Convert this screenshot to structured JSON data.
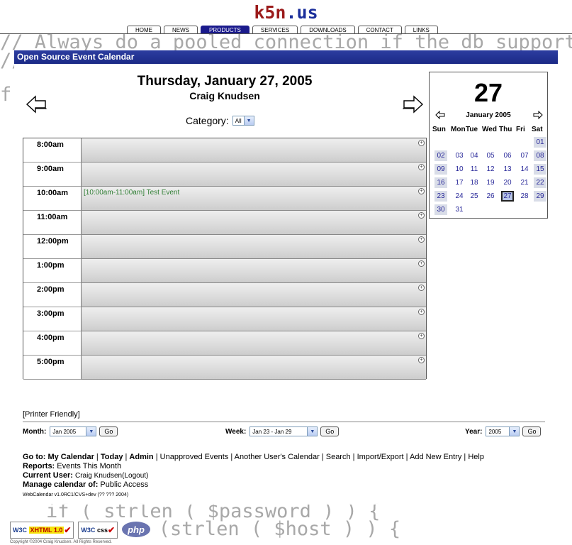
{
  "site": {
    "title_main": "k5n",
    "title_dot": ".",
    "title_tld": "us"
  },
  "nav": {
    "tabs": [
      {
        "label": "HOME",
        "active": false
      },
      {
        "label": "NEWS",
        "active": false
      },
      {
        "label": "PRODUCTS",
        "active": true
      },
      {
        "label": "SERVICES",
        "active": false
      },
      {
        "label": "DOWNLOADS",
        "active": false
      },
      {
        "label": "CONTACT",
        "active": false
      },
      {
        "label": "LINKS",
        "active": false
      }
    ]
  },
  "background_code": [
    "// Always do a pooled connection if the db supports",
    "//",
    "f",
    "",
    "",
    "",
    "",
    "",
    "",
    "",
    "",
    "",
    "",
    "",
    "",
    "",
    "",
    "    if ( strlen ( $password ) ) {",
    "       (strlen ( $host ) ) {"
  ],
  "panel": {
    "title": "Open Source Event Calendar"
  },
  "day": {
    "title": "Thursday, January 27, 2005",
    "user": "Craig Knudsen"
  },
  "category": {
    "label": "Category:",
    "value": "All"
  },
  "schedule": {
    "slots": [
      {
        "time": "8:00am",
        "event": ""
      },
      {
        "time": "9:00am",
        "event": ""
      },
      {
        "time": "10:00am",
        "event": "[10:00am-11:00am] Test Event"
      },
      {
        "time": "11:00am",
        "event": ""
      },
      {
        "time": "12:00pm",
        "event": ""
      },
      {
        "time": "1:00pm",
        "event": ""
      },
      {
        "time": "2:00pm",
        "event": ""
      },
      {
        "time": "3:00pm",
        "event": ""
      },
      {
        "time": "4:00pm",
        "event": ""
      },
      {
        "time": "5:00pm",
        "event": ""
      }
    ]
  },
  "mini_calendar": {
    "day": "27",
    "month": "January 2005",
    "weekdays": [
      "Sun",
      "Mon",
      "Tue",
      "Wed",
      "Thu",
      "Fri",
      "Sat"
    ],
    "weeks": [
      [
        "",
        "",
        "",
        "",
        "",
        "",
        "01"
      ],
      [
        "02",
        "03",
        "04",
        "05",
        "06",
        "07",
        "08"
      ],
      [
        "09",
        "10",
        "11",
        "12",
        "13",
        "14",
        "15"
      ],
      [
        "16",
        "17",
        "18",
        "19",
        "20",
        "21",
        "22"
      ],
      [
        "23",
        "24",
        "25",
        "26",
        "27",
        "28",
        "29"
      ],
      [
        "30",
        "31",
        "",
        "",
        "",
        "",
        ""
      ]
    ],
    "today": "27"
  },
  "footer": {
    "printer_friendly": "[Printer Friendly]",
    "month_label": "Month:",
    "month_value": "Jan 2005",
    "week_label": "Week:",
    "week_value": "Jan 23 - Jan 29",
    "year_label": "Year:",
    "year_value": "2005",
    "go_label": "Go",
    "goto_label": "Go to:",
    "goto_links": [
      "My Calendar",
      "Today",
      "Admin",
      "Unapproved Events",
      "Another User's Calendar",
      "Search",
      "Import/Export",
      "Add New Entry",
      "Help"
    ],
    "reports_label": "Reports:",
    "reports_link": "Events This Month",
    "current_user_label": "Current User:",
    "current_user": "Craig Knudsen",
    "logout": "(Logout)",
    "manage_label": "Manage calendar of:",
    "manage_value": "Public Access",
    "version": "WebCalendar v1.0RC1/CVS+dev (?? ??? 2004)"
  },
  "badges": {
    "xhtml_w3c": "W3C",
    "xhtml_label": "XHTML 1.0",
    "css_w3c": "W3C",
    "css_label": "css",
    "php": "php"
  },
  "copyright": "Copyright ©2004 Craig Knudsen. All Rights Reserved."
}
